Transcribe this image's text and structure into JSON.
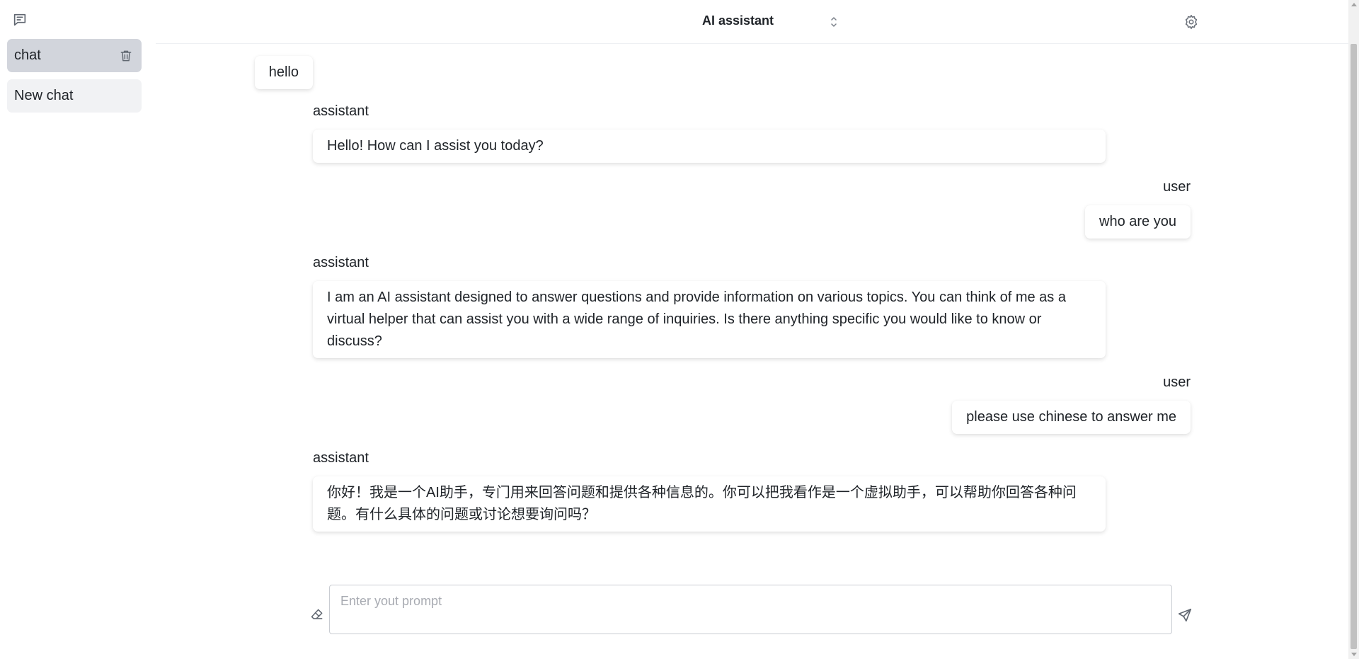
{
  "header": {
    "title": "AI assistant"
  },
  "sidebar": {
    "items": [
      {
        "label": "chat"
      },
      {
        "label": "New chat"
      }
    ]
  },
  "messages": [
    {
      "role": "user",
      "text": "hello"
    },
    {
      "role": "assistant",
      "text": "Hello! How can I assist you today?"
    },
    {
      "role": "user",
      "text": "who are you"
    },
    {
      "role": "assistant",
      "text": "I am an AI assistant designed to answer questions and provide information on various topics. You can think of me as a virtual helper that can assist you with a wide range of inquiries. Is there anything specific you would like to know or discuss?"
    },
    {
      "role": "user",
      "text": "please use chinese to answer me"
    },
    {
      "role": "assistant",
      "text": "你好！我是一个AI助手，专门用来回答问题和提供各种信息的。你可以把我看作是一个虚拟助手，可以帮助你回答各种问题。有什么具体的问题或讨论想要询问吗？"
    }
  ],
  "input": {
    "placeholder": "Enter yout prompt",
    "value": ""
  },
  "icons": {
    "new_chat": "new-chat-icon",
    "delete": "trash-icon",
    "select": "chevron-up-down-icon",
    "settings": "gear-icon",
    "clear": "eraser-icon",
    "send": "send-icon"
  }
}
